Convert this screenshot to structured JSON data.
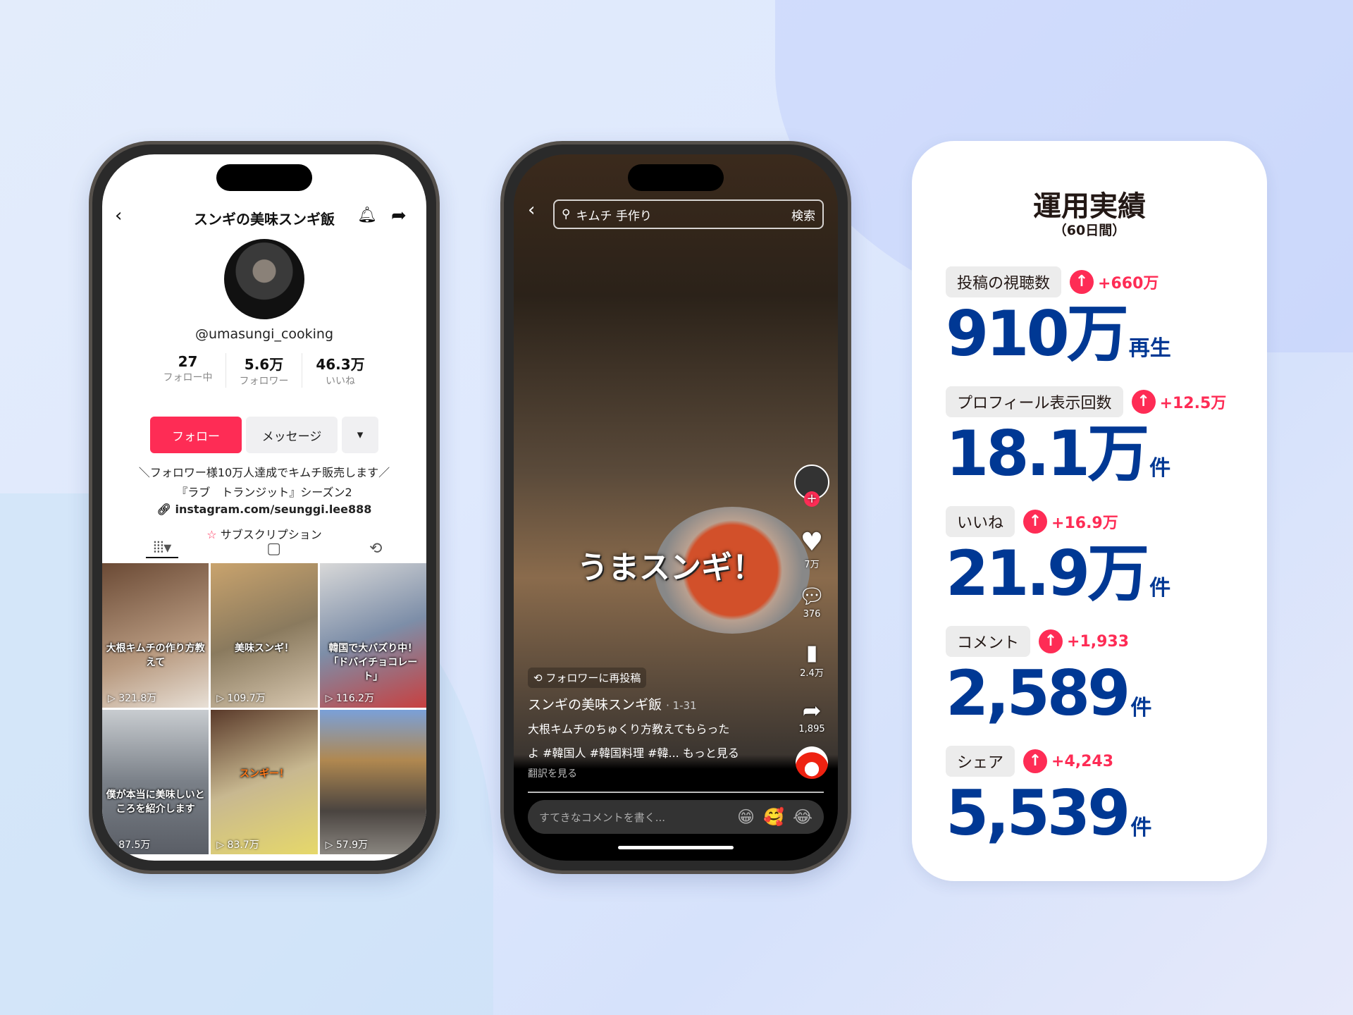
{
  "colors": {
    "accent": "#fe2c55",
    "metric_blue": "#003894"
  },
  "profile_phone": {
    "title": "スンギの美味スンギ飯",
    "handle": "@umasungi_cooking",
    "stats": [
      {
        "value": "27",
        "label": "フォロー中"
      },
      {
        "value": "5.6万",
        "label": "フォロワー"
      },
      {
        "value": "46.3万",
        "label": "いいね"
      }
    ],
    "follow_label": "フォロー",
    "message_label": "メッセージ",
    "more_label": "▾",
    "bio": [
      "＼フォロワー様10万人達成でキムチ販売します／",
      "『ラブ　トランジット』シーズン2"
    ],
    "link": "instagram.com/seunggi.lee888",
    "subscription": "サブスクリプション",
    "videos": [
      {
        "caption": "大根キムチの作り方教えて",
        "views": "321.8万"
      },
      {
        "caption": "美味スンギ！",
        "views": "109.7万"
      },
      {
        "caption": "韓国で大バズり中！「ドバイチョコレート」",
        "views": "116.2万"
      },
      {
        "caption": "僕が本当に美味しいところを紹介します",
        "views": "87.5万"
      },
      {
        "caption": "スンギー！",
        "views": "83.7万"
      },
      {
        "caption": "",
        "views": "57.9万"
      }
    ]
  },
  "video_phone": {
    "search_query": "キムチ 手作り",
    "search_button": "検索",
    "caption_overlay": "うまスンギ！",
    "likes": "7万",
    "comments": "376",
    "saves": "2.4万",
    "shares": "1,895",
    "repost_label": "フォロワーに再投稿",
    "author": "スンギの美味スンギ飯",
    "date": "· 1-31",
    "description": [
      "大根キムチのちゅくり方教えてもらった",
      "よ #韓国人 #韓国料理 #韓... もっと見る"
    ],
    "translate": "翻訳を見る",
    "comment_placeholder": "すてきなコメントを書く...",
    "emojis": [
      "😁",
      "🥰",
      "😂"
    ]
  },
  "results_card": {
    "title": "運用実績",
    "period": "（60日間）",
    "metrics": [
      {
        "label": "投稿の視聴数",
        "delta": "+660万",
        "value": "910万",
        "unit": "再生"
      },
      {
        "label": "プロフィール表示回数",
        "delta": "+12.5万",
        "value": "18.1万",
        "unit": "件"
      },
      {
        "label": "いいね",
        "delta": "+16.9万",
        "value": "21.9万",
        "unit": "件"
      },
      {
        "label": "コメント",
        "delta": "+1,933",
        "value": "2,589",
        "unit": "件"
      },
      {
        "label": "シェア",
        "delta": "+4,243",
        "value": "5,539",
        "unit": "件"
      }
    ]
  }
}
